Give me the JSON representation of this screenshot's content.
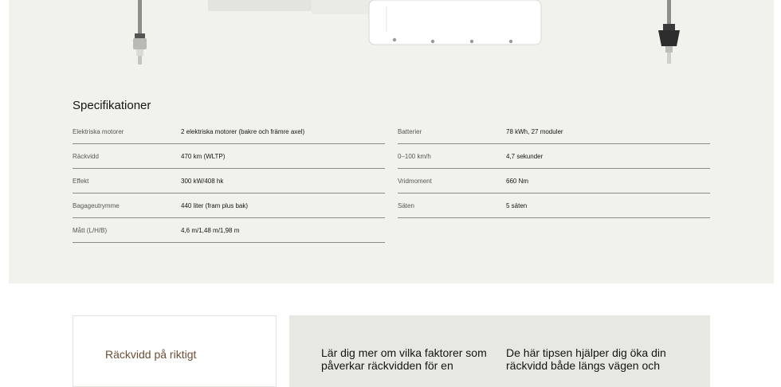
{
  "specs": {
    "title": "Specifikationer",
    "left": [
      {
        "label": "Elektriska motorer",
        "value": "2 elektriska motorer (bakre och främre axel)"
      },
      {
        "label": "Räckvidd",
        "value": "470 km (WLTP)"
      },
      {
        "label": "Effekt",
        "value": "300 kW/408 hk"
      },
      {
        "label": "Bagageutrymme",
        "value": "440 liter (fram plus bak)"
      },
      {
        "label": "Mått (L/H/B)",
        "value": "4,6 m/1,48 m/1,98 m"
      }
    ],
    "right": [
      {
        "label": "Batterier",
        "value": "78 kWh, 27 moduler"
      },
      {
        "label": "0–100 km/h",
        "value": "4,7 sekunder"
      },
      {
        "label": "Vridmoment",
        "value": "660 Nm"
      },
      {
        "label": "Säten",
        "value": "5 säten"
      }
    ]
  },
  "range_card": {
    "title": "Räckvidd på riktigt"
  },
  "info": {
    "text_a": "Lär dig mer om vilka faktorer som påverkar räckvidden för en",
    "text_b": "De här tipsen hjälper dig öka din räckvidd både längs vägen och"
  }
}
